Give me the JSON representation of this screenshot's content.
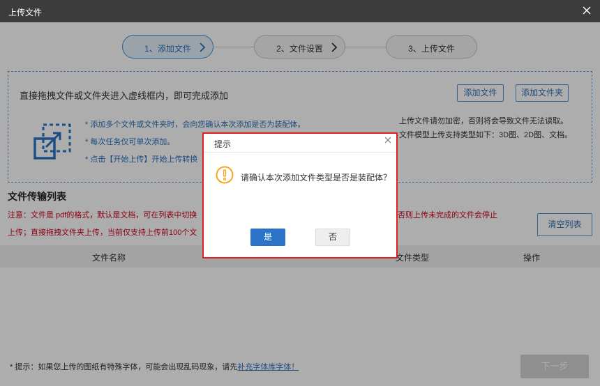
{
  "window": {
    "title": "上传文件"
  },
  "steps": [
    {
      "label": "1、添加文件",
      "active": true
    },
    {
      "label": "2、文件设置",
      "active": false
    },
    {
      "label": "3、上传文件",
      "active": false
    }
  ],
  "dropzone": {
    "title": "直接拖拽文件或文件夹进入虚线框内，即可完成添加",
    "add_file_label": "添加文件",
    "add_folder_label": "添加文件夹",
    "tips": [
      "* 添加多个文件或文件夹时，会向您确认本次添加是否为装配体。",
      "* 每次任务仅可单次添加。",
      "* 点击【开始上传】开始上传转换"
    ],
    "right_tips": [
      "上传文件请勿加密，否则将会导致文件无法读取。",
      "文件模型上传支持类型如下：3D图、2D图、文档。"
    ]
  },
  "transfer": {
    "title": "文件传输列表",
    "notice_line1_left": "注意：文件是 pdf的格式，默认是文档，可在列表中切换",
    "notice_line1_right": "否则上传未完成的文件会停止",
    "notice_line2_left": "上传；直接拖拽文件夹上传，当前仅支持上传前100个文",
    "clear_label": "清空列表",
    "columns": [
      "文件名称",
      "文件类型",
      "操作"
    ]
  },
  "footer": {
    "tip_prefix": "* 提示：如果您上传的图纸有特殊字体，可能会出现乱码现象，请先",
    "tip_link": "补充字体库字体！",
    "next_label": "下一步"
  },
  "dialog": {
    "title": "提示",
    "message": "请确认本次添加文件类型是否是装配体？",
    "yes_label": "是",
    "no_label": "否"
  },
  "colors": {
    "accent": "#2a73c6",
    "warning": "#f5a623",
    "notice": "#d0021b",
    "highlight_border": "#e02020"
  },
  "icons": [
    "close-icon",
    "chevron-right-icon",
    "drag-drop-icon",
    "warning-icon"
  ]
}
